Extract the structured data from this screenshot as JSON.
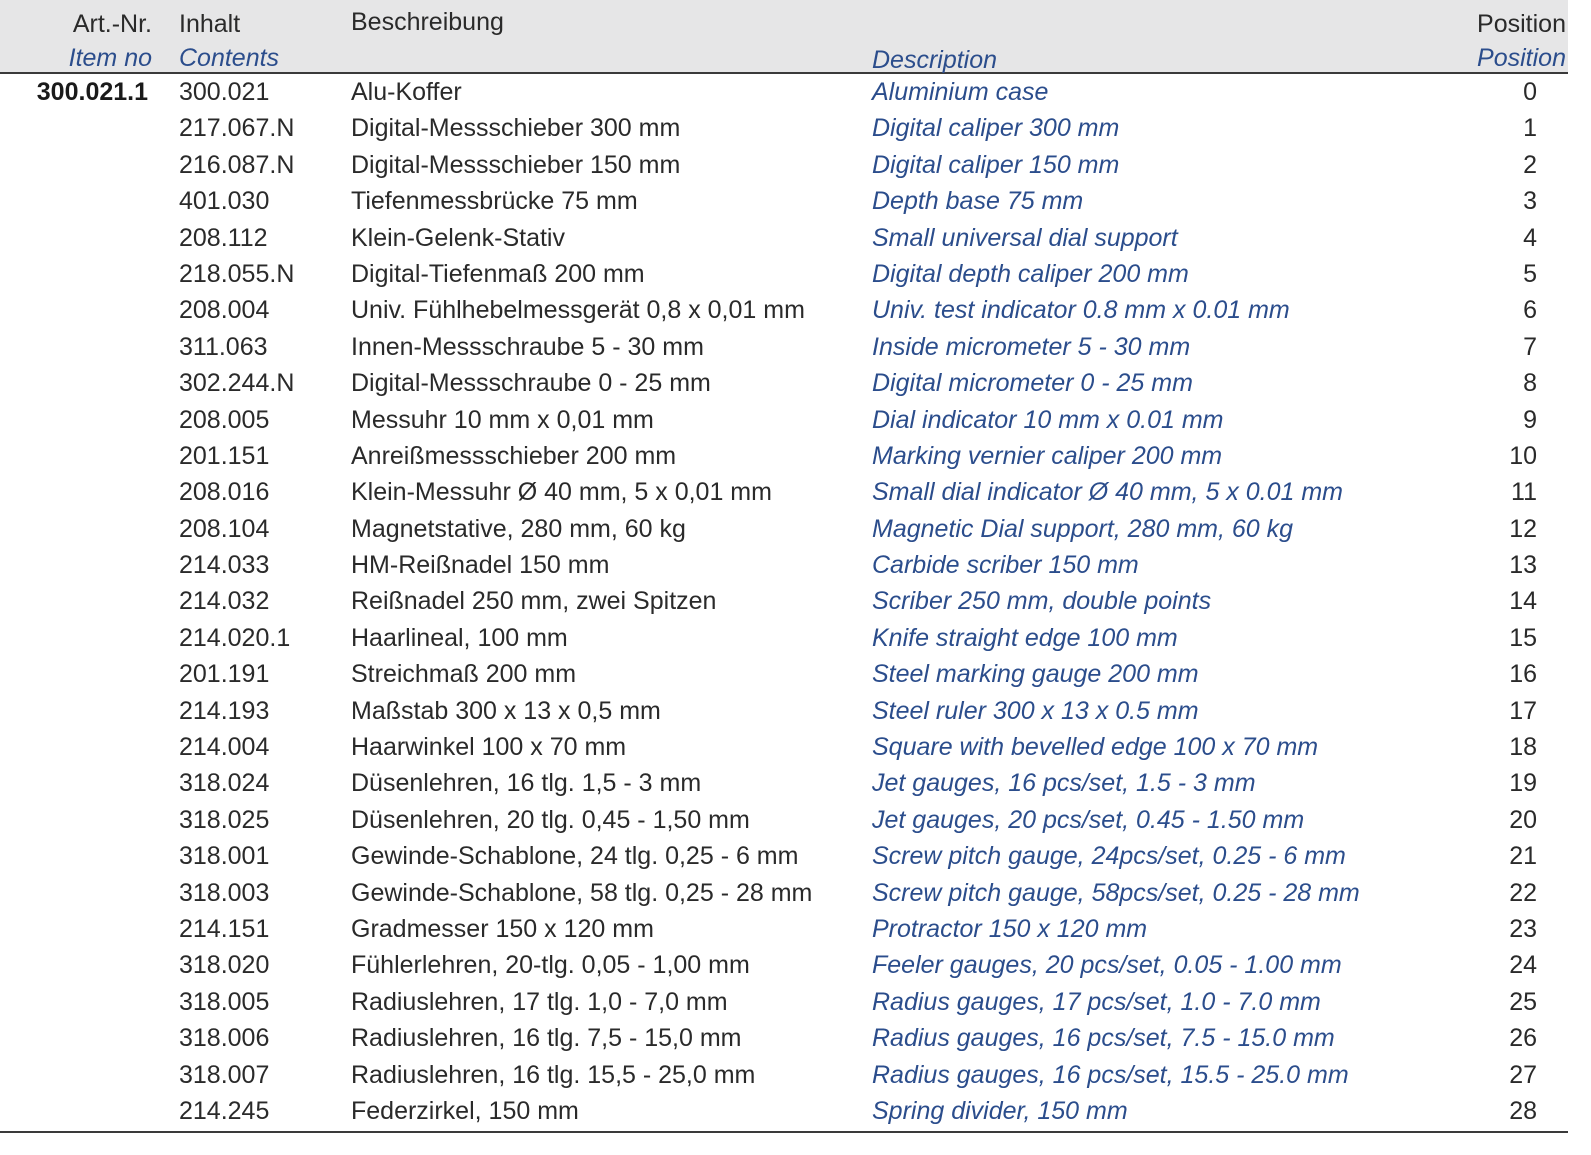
{
  "header": {
    "item_de": "Art.-Nr.",
    "item_en": "Item no",
    "contents_de": "Inhalt",
    "contents_en": "Contents",
    "description_de": "Beschreibung",
    "description_en": "Description",
    "position_de": "Position",
    "position_en": "Position"
  },
  "rows": [
    {
      "item": "300.021.1",
      "contents": "300.021",
      "description": "Alu-Koffer",
      "english": "Aluminium case",
      "position": "0"
    },
    {
      "item": "",
      "contents": "217.067.N",
      "description": "Digital-Messschieber 300 mm",
      "english": "Digital caliper 300 mm",
      "position": "1"
    },
    {
      "item": "",
      "contents": "216.087.N",
      "description": "Digital-Messschieber 150 mm",
      "english": "Digital caliper 150 mm",
      "position": "2"
    },
    {
      "item": "",
      "contents": "401.030",
      "description": "Tiefenmessbrücke 75 mm",
      "english": "Depth base 75 mm",
      "position": "3"
    },
    {
      "item": "",
      "contents": "208.112",
      "description": "Klein-Gelenk-Stativ",
      "english": "Small universal dial support",
      "position": "4"
    },
    {
      "item": "",
      "contents": "218.055.N",
      "description": "Digital-Tiefenmaß 200 mm",
      "english": "Digital depth caliper 200 mm",
      "position": "5"
    },
    {
      "item": "",
      "contents": "208.004",
      "description": "Univ. Fühlhebelmessgerät 0,8 x 0,01 mm",
      "english": "Univ. test indicator 0.8 mm x 0.01 mm",
      "position": "6"
    },
    {
      "item": "",
      "contents": "311.063",
      "description": "Innen-Messschraube 5 - 30 mm",
      "english": "Inside micrometer 5 - 30 mm",
      "position": "7"
    },
    {
      "item": "",
      "contents": "302.244.N",
      "description": "Digital-Messschraube 0 - 25 mm",
      "english": "Digital micrometer 0 - 25 mm",
      "position": "8"
    },
    {
      "item": "",
      "contents": "208.005",
      "description": "Messuhr 10 mm x 0,01 mm",
      "english": "Dial indicator 10 mm x 0.01 mm",
      "position": "9"
    },
    {
      "item": "",
      "contents": "201.151",
      "description": "Anreißmessschieber 200 mm",
      "english": "Marking vernier caliper 200 mm",
      "position": "10"
    },
    {
      "item": "",
      "contents": "208.016",
      "description": "Klein-Messuhr Ø 40 mm, 5 x 0,01 mm",
      "english": "Small dial indicator Ø 40 mm, 5 x 0.01 mm",
      "position": "11"
    },
    {
      "item": "",
      "contents": "208.104",
      "description": "Magnetstative, 280 mm, 60 kg",
      "english": "Magnetic Dial support, 280 mm, 60 kg",
      "position": "12"
    },
    {
      "item": "",
      "contents": "214.033",
      "description": "HM-Reißnadel 150 mm",
      "english": "Carbide scriber 150 mm",
      "position": "13"
    },
    {
      "item": "",
      "contents": "214.032",
      "description": "Reißnadel 250 mm, zwei Spitzen",
      "english": "Scriber 250 mm, double points",
      "position": "14"
    },
    {
      "item": "",
      "contents": "214.020.1",
      "description": "Haarlineal, 100 mm",
      "english": "Knife straight edge 100 mm",
      "position": "15"
    },
    {
      "item": "",
      "contents": "201.191",
      "description": "Streichmaß 200 mm",
      "english": "Steel marking gauge 200 mm",
      "position": "16"
    },
    {
      "item": "",
      "contents": "214.193",
      "description": "Maßstab 300 x 13 x 0,5 mm",
      "english": "Steel ruler 300 x 13 x 0.5 mm",
      "position": "17"
    },
    {
      "item": "",
      "contents": "214.004",
      "description": "Haarwinkel 100 x 70 mm",
      "english": "Square with bevelled edge 100 x 70 mm",
      "position": "18"
    },
    {
      "item": "",
      "contents": "318.024",
      "description": "Düsenlehren, 16 tlg. 1,5 - 3 mm",
      "english": "Jet gauges, 16 pcs/set, 1.5 - 3 mm",
      "position": "19"
    },
    {
      "item": "",
      "contents": "318.025",
      "description": "Düsenlehren, 20 tlg. 0,45 - 1,50 mm",
      "english": "Jet gauges, 20 pcs/set, 0.45 - 1.50 mm",
      "position": "20"
    },
    {
      "item": "",
      "contents": "318.001",
      "description": "Gewinde-Schablone, 24 tlg. 0,25 - 6 mm",
      "english": "Screw pitch gauge, 24pcs/set, 0.25 - 6 mm",
      "position": "21"
    },
    {
      "item": "",
      "contents": "318.003",
      "description": "Gewinde-Schablone, 58 tlg. 0,25 - 28 mm",
      "english": "Screw pitch gauge, 58pcs/set, 0.25 - 28 mm",
      "position": "22"
    },
    {
      "item": "",
      "contents": "214.151",
      "description": "Gradmesser 150 x 120 mm",
      "english": "Protractor 150 x 120 mm",
      "position": "23"
    },
    {
      "item": "",
      "contents": "318.020",
      "description": "Fühlerlehren, 20-tlg. 0,05 - 1,00 mm",
      "english": "Feeler gauges, 20 pcs/set, 0.05 - 1.00 mm",
      "position": "24"
    },
    {
      "item": "",
      "contents": "318.005",
      "description": "Radiuslehren, 17 tlg. 1,0 - 7,0 mm",
      "english": "Radius gauges, 17 pcs/set, 1.0 - 7.0 mm",
      "position": "25"
    },
    {
      "item": "",
      "contents": "318.006",
      "description": "Radiuslehren, 16 tlg. 7,5 - 15,0 mm",
      "english": "Radius gauges, 16 pcs/set, 7.5 - 15.0 mm",
      "position": "26"
    },
    {
      "item": "",
      "contents": "318.007",
      "description": "Radiuslehren, 16 tlg. 15,5 - 25,0 mm",
      "english": "Radius gauges, 16 pcs/set, 15.5 - 25.0 mm",
      "position": "27"
    },
    {
      "item": "",
      "contents": "214.245",
      "description": "Federzirkel, 150 mm",
      "english": "Spring divider, 150 mm",
      "position": "28"
    }
  ]
}
